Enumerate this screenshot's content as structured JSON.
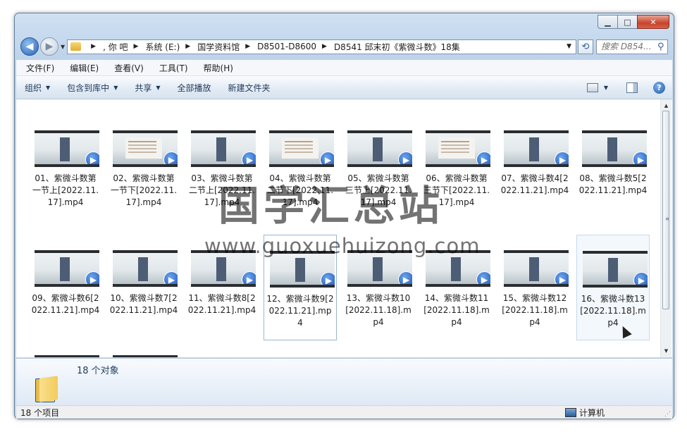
{
  "window": {
    "min": "▁",
    "max": "□",
    "close": "✕"
  },
  "nav": {
    "back_icon": "◀",
    "forward_icon": "▶",
    "crumbs": [
      ", 你  吧",
      "系统 (E:)",
      "国学资料馆",
      "D8501-D8600",
      "D8541 邱末初《紫微斗数》18集"
    ],
    "search_placeholder": "搜索 D854..."
  },
  "menu": [
    "文件(F)",
    "编辑(E)",
    "查看(V)",
    "工具(T)",
    "帮助(H)"
  ],
  "toolbar": {
    "organize": "组织",
    "include": "包含到库中",
    "share": "共享",
    "play_all": "全部播放",
    "new_folder": "新建文件夹"
  },
  "files": [
    {
      "name": "01、紫微斗数第一节上[2022.11.17].mp4",
      "thumb": "scroll"
    },
    {
      "name": "02、紫微斗数第一节下[2022.11.17].mp4",
      "thumb": "text"
    },
    {
      "name": "03、紫微斗数第二节上[2022.11.17].mp4",
      "thumb": "scroll"
    },
    {
      "name": "04、紫微斗数第二节下[2022.11.17].mp4",
      "thumb": "text"
    },
    {
      "name": "05、紫微斗数第三节上[2022.11.17].mp4",
      "thumb": "scroll"
    },
    {
      "name": "06、紫微斗数第三节下[2022.11.17].mp4",
      "thumb": "text"
    },
    {
      "name": "07、紫微斗数4[2022.11.21].mp4",
      "thumb": "scroll"
    },
    {
      "name": "08、紫微斗数5[2022.11.21].mp4",
      "thumb": "scroll"
    },
    {
      "name": "09、紫微斗数6[2022.11.21].mp4",
      "thumb": "scroll"
    },
    {
      "name": "10、紫微斗数7[2022.11.21].mp4",
      "thumb": "scroll"
    },
    {
      "name": "11、紫微斗数8[2022.11.21].mp4",
      "thumb": "scroll"
    },
    {
      "name": "12、紫微斗数9[2022.11.21].mp4",
      "thumb": "scroll",
      "state": "sel"
    },
    {
      "name": "13、紫微斗数10[2022.11.18].mp4",
      "thumb": "scroll"
    },
    {
      "name": "14、紫微斗数11[2022.11.18].mp4",
      "thumb": "scroll"
    },
    {
      "name": "15、紫微斗数12[2022.11.18].mp4",
      "thumb": "scroll"
    },
    {
      "name": "16、紫微斗数13[2022.11.18].mp4",
      "thumb": "scroll",
      "state": "hl"
    }
  ],
  "watermark": {
    "text": "国学汇总站",
    "url": "www.guoxuehuizong.com"
  },
  "details": {
    "count": "18 个对象"
  },
  "status": {
    "items": "18 个项目",
    "location": "计算机"
  }
}
